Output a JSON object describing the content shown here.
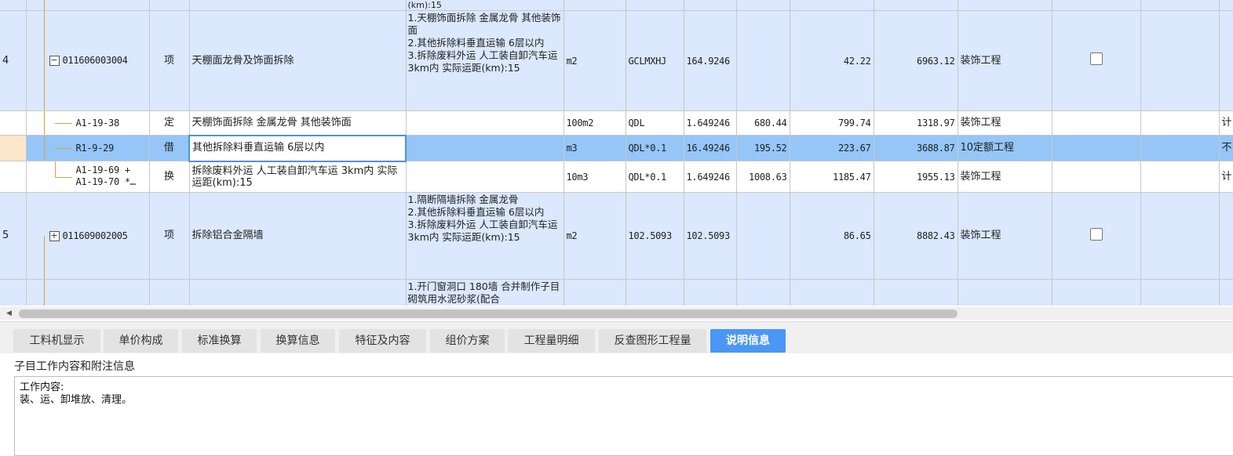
{
  "rows": [
    {
      "num": "",
      "code": "",
      "type": "",
      "name": "",
      "desc": "(km):15",
      "unit": "",
      "expr": "",
      "qty": "",
      "price": "",
      "unitprice": "",
      "total": "",
      "project": ""
    },
    {
      "num": "4",
      "code": "011606003004",
      "type": "项",
      "name": "天棚面龙骨及饰面拆除",
      "desc": "1.天棚饰面拆除 金属龙骨 其他装饰面\n2.其他拆除料垂直运输 6层以内\n3.拆除废料外运 人工装自卸汽车运 3km内 实际运距(km):15",
      "unit": "m2",
      "expr": "GCLMXHJ",
      "qty": "164.9246",
      "price": "",
      "unitprice": "42.22",
      "total": "6963.12",
      "project": "装饰工程"
    },
    {
      "num": "",
      "code": "A1-19-38",
      "type": "定",
      "name": "天棚饰面拆除 金属龙骨 其他装饰面",
      "desc": "",
      "unit": "100m2",
      "expr": "QDL",
      "qty": "1.649246",
      "price": "680.44",
      "unitprice": "799.74",
      "total": "1318.97",
      "project": "装饰工程",
      "extra": "计"
    },
    {
      "num": "",
      "code": "R1-9-29",
      "type": "借",
      "name": "其他拆除料垂直运输 6层以内",
      "desc": "",
      "unit": "m3",
      "expr": "QDL*0.1",
      "qty": "16.49246",
      "price": "195.52",
      "unitprice": "223.67",
      "total": "3688.87",
      "project": "10定额工程",
      "extra": "不"
    },
    {
      "num": "",
      "code": "A1-19-69 + A1-19-70 *…",
      "type": "换",
      "name": "拆除废料外运 人工装自卸汽车运 3km内 实际运距(km):15",
      "desc": "",
      "unit": "10m3",
      "expr": "QDL*0.1",
      "qty": "1.649246",
      "price": "1008.63",
      "unitprice": "1185.47",
      "total": "1955.13",
      "project": "装饰工程",
      "extra": "计"
    },
    {
      "num": "5",
      "code": "011609002005",
      "type": "项",
      "name": "拆除铝合金隔墙",
      "desc": "1.隔断隔墙拆除 金属龙骨\n2.其他拆除料垂直运输 6层以内\n3.拆除废料外运 人工装自卸汽车运 3km内 实际运距(km):15",
      "unit": "m2",
      "expr": "102.5093",
      "qty": "102.5093",
      "price": "",
      "unitprice": "86.65",
      "total": "8882.43",
      "project": "装饰工程"
    },
    {
      "num": "",
      "code": "",
      "type": "",
      "name": "",
      "desc": "1.开门窗洞口 180墙 合并制作子目 砌筑用水泥砂浆(配合",
      "unit": "",
      "expr": "",
      "qty": "",
      "price": "",
      "unitprice": "",
      "total": "",
      "project": ""
    }
  ],
  "tabs": [
    "工料机显示",
    "单价构成",
    "标准换算",
    "换算信息",
    "特征及内容",
    "组价方案",
    "工程量明细",
    "反查图形工程量",
    "说明信息"
  ],
  "info": {
    "title": "子目工作内容和附注信息",
    "line1": "工作内容:",
    "line2": "装、运、卸堆放、清理。"
  },
  "colors": {
    "item_row": "#dbe8fd",
    "selected_row": "#95c6f7",
    "active_tab": "#4b97f5"
  }
}
